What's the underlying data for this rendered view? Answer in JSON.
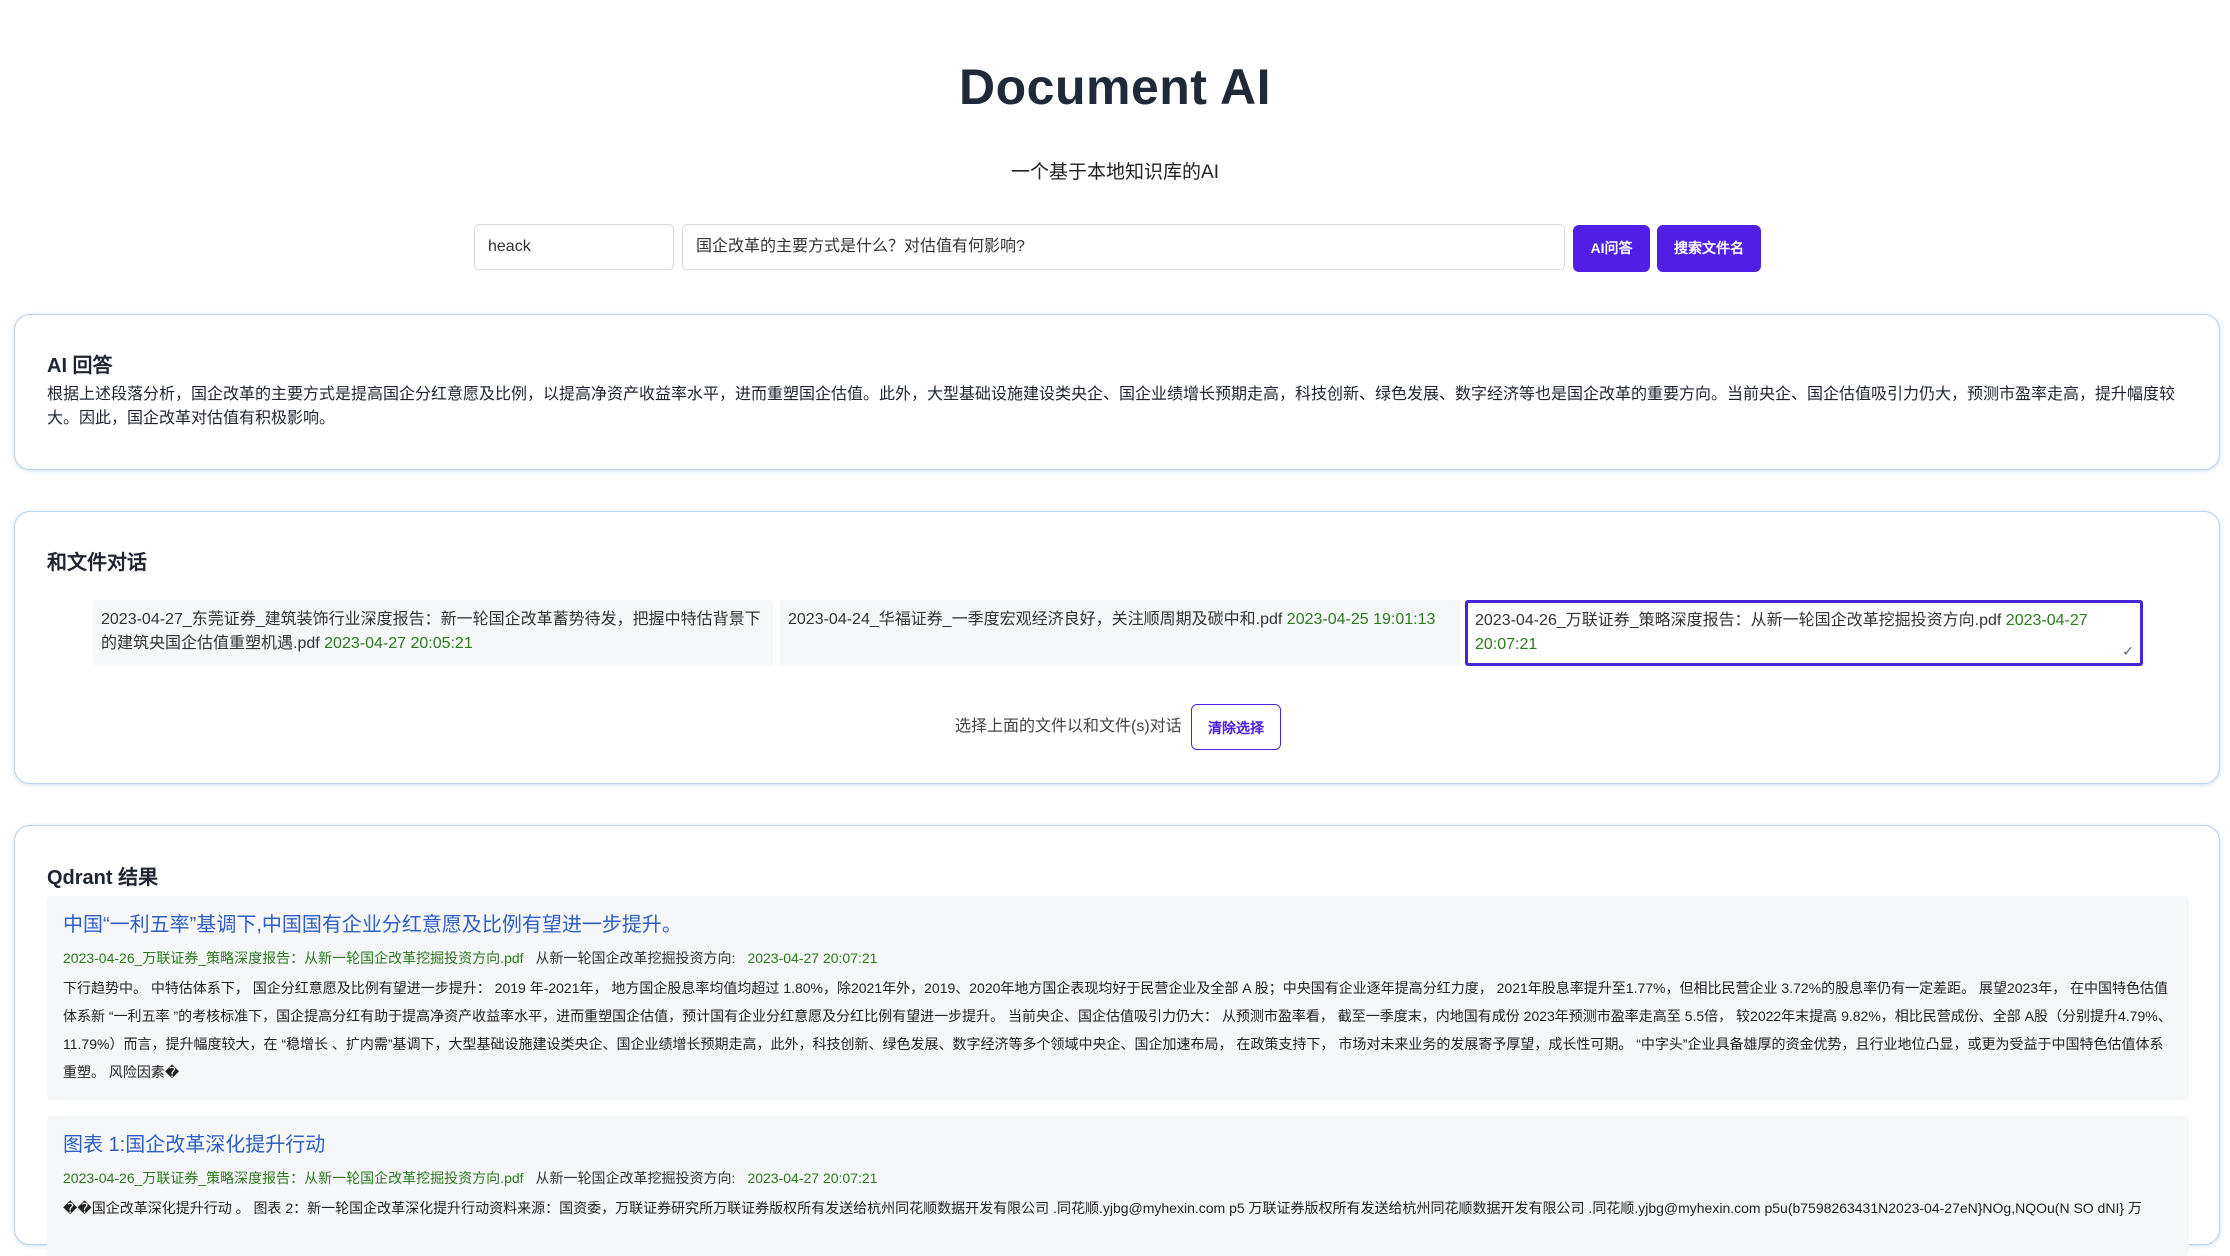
{
  "header": {
    "title": "Document AI",
    "subtitle": "一个基于本地知识库的AI"
  },
  "search": {
    "user_value": "heack",
    "question_value": "国企改革的主要方式是什么？对估值有何影响?",
    "ask_button": "AI问答",
    "filename_button": "搜索文件名"
  },
  "answer": {
    "heading": "AI 回答",
    "text": "根据上述段落分析，国企改革的主要方式是提高国企分红意愿及比例，以提高净资产收益率水平，进而重塑国企估值。此外，大型基础设施建设类央企、国企业绩增长预期走高，科技创新、绿色发展、数字经济等也是国企改革的重要方向。当前央企、国企估值吸引力仍大，预测市盈率走高，提升幅度较大。因此，国企改革对估值有积极影响。"
  },
  "files": {
    "heading": "和文件对话",
    "items": [
      {
        "name": "2023-04-27_东莞证券_建筑装饰行业深度报告：新一轮国企改革蓄势待发，把握中特估背景下的建筑央国企估值重塑机遇.pdf",
        "date": "2023-04-27 20:05:21",
        "selected": false
      },
      {
        "name": "2023-04-24_华福证券_一季度宏观经济良好，关注顺周期及碳中和.pdf",
        "date": "2023-04-25 19:01:13",
        "selected": false
      },
      {
        "name": "2023-04-26_万联证券_策略深度报告：从新一轮国企改革挖掘投资方向.pdf",
        "date": "2023-04-27 20:07:21",
        "selected": true
      }
    ],
    "checkmark": "✓",
    "hint": "选择上面的文件以和文件(s)对话",
    "clear_button": "清除选择"
  },
  "results": {
    "heading": "Qdrant 结果",
    "items": [
      {
        "title": "中国“一利五率”基调下,中国国有企业分红意愿及比例有望进一步提升。",
        "file": "2023-04-26_万联证券_策略深度报告：从新一轮国企改革挖掘投资方向.pdf",
        "section": "从新一轮国企改革挖掘投资方向:",
        "date": "2023-04-27 20:07:21",
        "body": "下行趋势中。 中特估体系下， 国企分红意愿及比例有望进一步提升： 2019 年-2021年， 地方国企股息率均值均超过 1.80%，除2021年外，2019、2020年地方国企表现均好于民营企业及全部 A 股；中央国有企业逐年提高分红力度， 2021年股息率提升至1.77%，但相比民营企业 3.72%的股息率仍有一定差距。 展望2023年， 在中国特色估值体系新 “一利五率 ”的考核标准下，国企提高分红有助于提高净资产收益率水平，进而重塑国企估值，预计国有企业分红意愿及分红比例有望进一步提升。 当前央企、国企估值吸引力仍大： 从预测市盈率看， 截至一季度末，内地国有成份 2023年预测市盈率走高至 5.5倍， 较2022年末提高 9.82%，相比民营成份、全部 A股（分别提升4.79%、11.79%）而言，提升幅度较大，在 “稳增长 、扩内需”基调下，大型基础设施建设类央企、国企业绩增长预期走高，此外，科技创新、绿色发展、数字经济等多个领域中央企、国企加速布局， 在政策支持下， 市场对未来业务的发展寄予厚望，成长性可期。 “中字头”企业具备雄厚的资金优势，且行业地位凸显，或更为受益于中国特色估值体系重塑。 风险因素�"
      },
      {
        "title": "图表 1:国企改革深化提升行动",
        "file": "2023-04-26_万联证券_策略深度报告：从新一轮国企改革挖掘投资方向.pdf",
        "section": "从新一轮国企改革挖掘投资方向:",
        "date": "2023-04-27 20:07:21",
        "body": "��国企改革深化提升行动 。 图表 2：新一轮国企改革深化提升行动资料来源：国资委，万联证券研究所万联证券版权所有发送给杭州同花顺数据开发有限公司 .同花顺.yjbg@myhexin.com p5 万联证券版权所有发送给杭州同花顺数据开发有限公司 .同花顺.yjbg@myhexin.com p5u(b7598263431N2023-04-27eN}NOg,NQOu(N SO dNI} 万"
      }
    ]
  }
}
